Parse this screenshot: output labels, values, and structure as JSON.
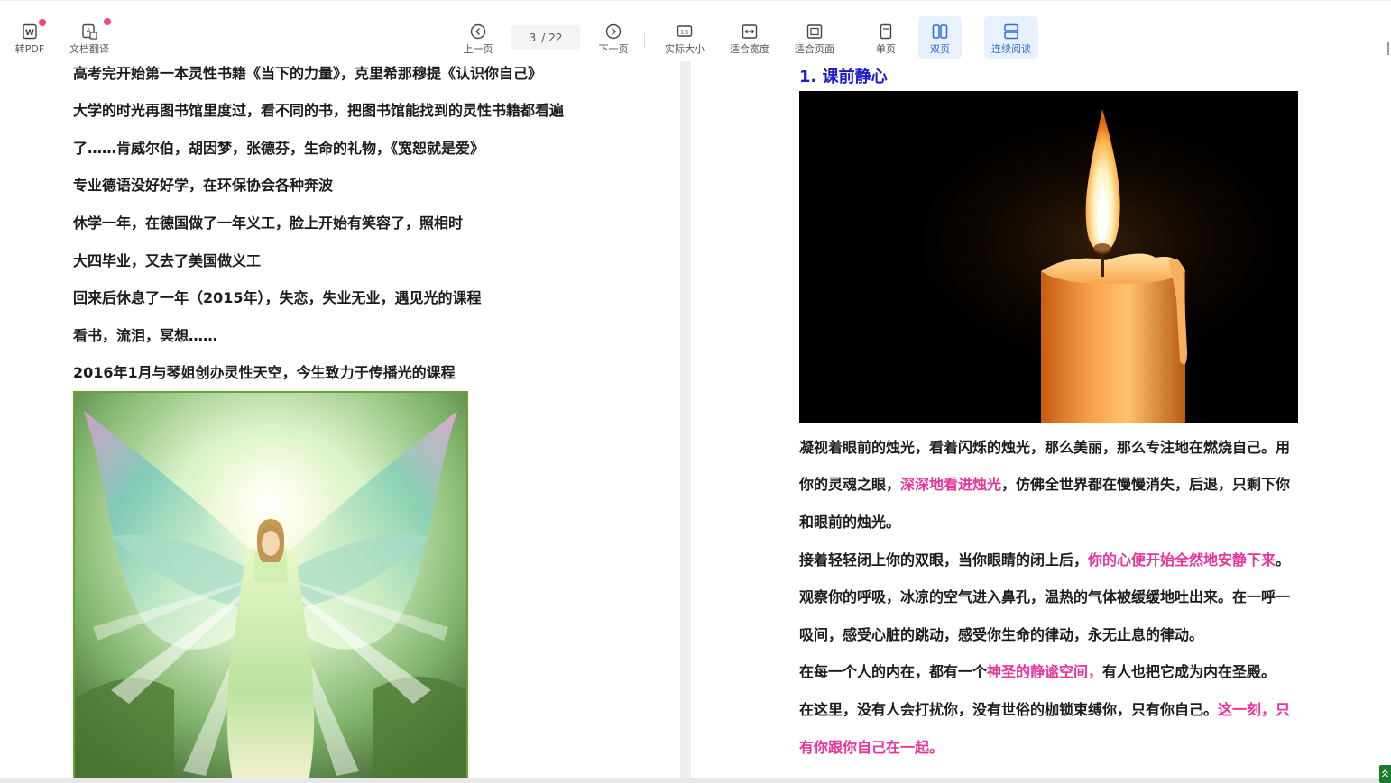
{
  "toolbar": {
    "to_pdf": "转PDF",
    "translate": "文档翻译",
    "prev": "上一页",
    "page_current": "3",
    "page_total": "/ 22",
    "next": "下一页",
    "actual_size": "实际大小",
    "fit_width": "适合宽度",
    "fit_page": "适合页面",
    "single": "单页",
    "double": "双页",
    "continuous": "连续阅读",
    "accent_color": "#2f6bd8",
    "badge_color": "#f5476b"
  },
  "left_page": {
    "lines": [
      "高考完开始第一本灵性书籍《当下的力量》，克里希那穆提《认识你自己》",
      "大学的时光再图书馆里度过，看不同的书，把图书馆能找到的灵性书籍都看遍",
      "了……肯威尔伯，胡因梦，张德芬，生命的礼物，《宽恕就是爱》",
      "专业德语没好好学，在环保协会各种奔波",
      "休学一年，在德国做了一年义工，脸上开始有笑容了，照相时",
      "大四毕业，又去了美国做义工",
      "回来后休息了一年（2015年），失恋，失业无业，遇见光的课程",
      "看书，流泪，冥想……",
      "2016年1月与琴姐创办灵性天空，今生致力于传播光的课程"
    ]
  },
  "right_page": {
    "title": "1. 课前静心",
    "p1a": "凝视着眼前的烛光，看着闪烁的烛光，那么美丽，那么专注地在燃烧自己。用",
    "p1b_pre": "你的灵魂之眼，",
    "p1b_pink": "深深地看进烛光",
    "p1b_post": "，仿佛全世界都在慢慢消失，后退，只剩下你",
    "p1c": "和眼前的烛光。",
    "p2_pre": "接着轻轻闭上你的双眼，当你眼睛的闭上后，",
    "p2_pink": "你的心便开始全然地安静下来",
    "p2_post": "。",
    "p3a": "观察你的呼吸，冰凉的空气进入鼻孔，温热的气体被缓缓地吐出来。在一呼一",
    "p3b": "吸间，感受心脏的跳动，感受你生命的律动，永无止息的律动。",
    "p4_pre": "在每一个人的内在，都有一个",
    "p4_pink": "神圣的静谧空间，",
    "p4_post": "有人也把它成为内在圣殿。",
    "p5_pre": "在这里，没有人会打扰你，没有世俗的枷锁束缚你，只有你自己。",
    "p5_pink": "这一刻，只",
    "p6_pink": "有你跟你自己在一起。",
    "pink_color": "#e8339a",
    "title_color": "#1a1ac9"
  }
}
